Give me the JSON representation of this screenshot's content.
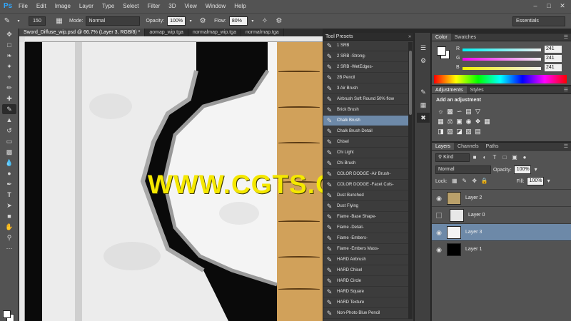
{
  "app": {
    "logo": "Ps"
  },
  "menu": [
    "File",
    "Edit",
    "Image",
    "Layer",
    "Type",
    "Select",
    "Filter",
    "3D",
    "View",
    "Window",
    "Help"
  ],
  "options": {
    "brush_size": "150",
    "mode_label": "Mode:",
    "mode_value": "Normal",
    "opacity_label": "Opacity:",
    "opacity_value": "100%",
    "flow_label": "Flow:",
    "flow_value": "80%",
    "workspace": "Essentials"
  },
  "doc_tabs": [
    "Sword_Diffuse_wip.psd @ 66.7% (Layer 3, RGB/8) *",
    "aomap_wip.tga",
    "normalmap_wip.tga",
    "normalmap.tga"
  ],
  "watermark": "WWW.CGTS.COM",
  "tool_presets": {
    "title": "Tool Presets",
    "items": [
      "1 SRB",
      "2 SRB -Strong-",
      "2 SRB -WetEdges-",
      "2B Pencil",
      "3 Air Brush",
      "Airbrush Soft Round 50% flow",
      "Brick Brush",
      "Chalk Brush",
      "Chalk Brush Detail",
      "Chisel",
      "Chi Light",
      "Chi Brush",
      "COLOR DODGE -Air Brush-",
      "COLOR DODGE -Facet Cuts-",
      "Dust Bunched",
      "Dust Flying",
      "Flame -Base Shape-",
      "Flame -Detail-",
      "Flame -Embers-",
      "Flame -Embers Mass-",
      "HARD Airbrush",
      "HARD Chisel",
      "HARD Circle",
      "HARD Square",
      "HARD Texture",
      "Non-Photo Blue Pencil"
    ],
    "selected": "Chalk Brush"
  },
  "color_panel": {
    "tabs": [
      "Color",
      "Swatches"
    ],
    "r_label": "R",
    "r_value": "241",
    "g_label": "G",
    "g_value": "241",
    "b_label": "B",
    "b_value": "241",
    "fg_color": "#ffffff"
  },
  "adjustments": {
    "tabs": [
      "Adjustments",
      "Styles"
    ],
    "title": "Add an adjustment"
  },
  "layers": {
    "tabs": [
      "Layers",
      "Channels",
      "Paths"
    ],
    "kind": "Kind",
    "blend": "Normal",
    "opacity_label": "Opacity:",
    "opacity_value": "100%",
    "lock_label": "Lock:",
    "fill_label": "Fill:",
    "fill_value": "100%",
    "items": [
      {
        "name": "Layer 2",
        "visible": true
      },
      {
        "name": "Layer 0",
        "visible": false
      },
      {
        "name": "Layer 3",
        "visible": true,
        "selected": true
      },
      {
        "name": "Layer 1",
        "visible": true
      }
    ]
  },
  "colors": {
    "accent": "#6d89a8",
    "panel": "#535353",
    "watermark": "#f5e800"
  }
}
